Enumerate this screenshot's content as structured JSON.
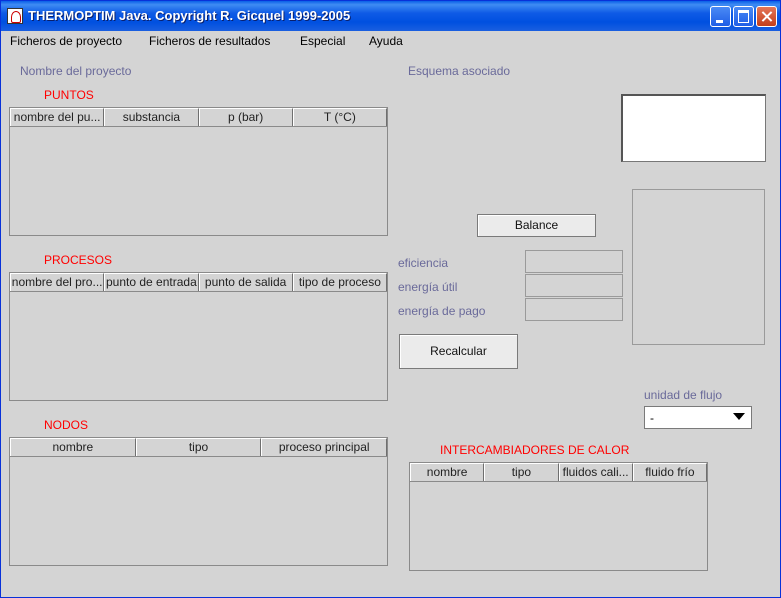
{
  "window": {
    "title": "THERMOPTIM Java. Copyright R. Gicquel 1999-2005"
  },
  "menu": [
    "Ficheros de proyecto",
    "Ficheros de resultados",
    "Especial",
    "Ayuda"
  ],
  "project_label": "Nombre del proyecto",
  "schema_label": "Esquema asociado",
  "puntos": {
    "title": "PUNTOS",
    "columns": [
      "nombre del pu...",
      "substancia",
      "p (bar)",
      "T (°C)"
    ]
  },
  "procesos": {
    "title": "PROCESOS",
    "columns": [
      "nombre del pro...",
      "punto de entrada",
      "punto de salida",
      "tipo de proceso"
    ]
  },
  "nodos": {
    "title": "NODOS",
    "columns": [
      "nombre",
      "tipo",
      "proceso principal"
    ]
  },
  "intercambiadores": {
    "title": "INTERCAMBIADORES DE CALOR",
    "columns": [
      "nombre",
      "tipo",
      "fluidos cali...",
      "fluido frío"
    ]
  },
  "balance": {
    "button": "Balance",
    "eficiencia_label": "eficiencia",
    "energia_util_label": "energía útil",
    "energia_pago_label": "energía de pago",
    "recalcular_button": "Recalcular"
  },
  "flow_unit": {
    "label": "unidad de flujo",
    "value": "-"
  }
}
